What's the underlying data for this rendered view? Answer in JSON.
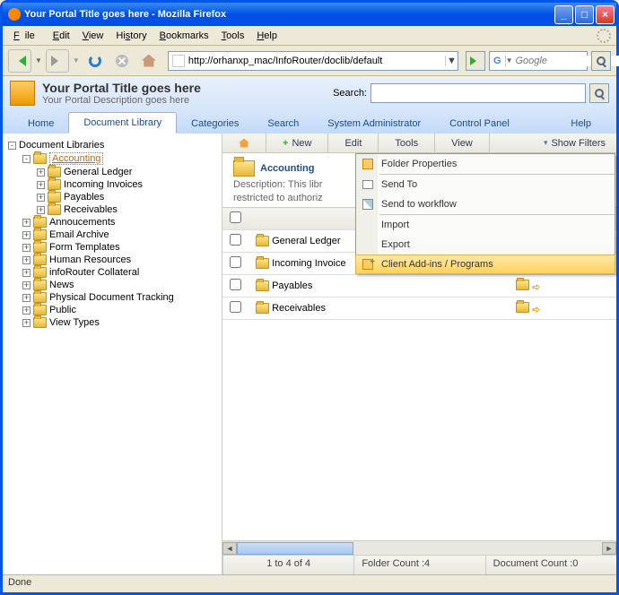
{
  "titlebar": {
    "text": "Your Portal Title goes here - Mozilla Firefox"
  },
  "menubar": [
    "File",
    "Edit",
    "View",
    "History",
    "Bookmarks",
    "Tools",
    "Help"
  ],
  "url": "http://orhanxp_mac/InfoRouter/doclib/default",
  "search_engine_placeholder": "Google",
  "portal": {
    "title": "Your Portal Title goes here",
    "description": "Your Portal Description goes here",
    "search_label": "Search:"
  },
  "nav": {
    "home": "Home",
    "doclib": "Document Library",
    "categories": "Categories",
    "search": "Search",
    "sysadmin": "System Administrator",
    "cpanel": "Control Panel",
    "help": "Help"
  },
  "tree": {
    "root": "Document Libraries",
    "accounting": "Accounting",
    "accounting_children": [
      "General Ledger",
      "Incoming Invoices",
      "Payables",
      "Receivables"
    ],
    "siblings": [
      "Annoucements",
      "Email Archive",
      "Form Templates",
      "Human Resources",
      "infoRouter Collateral",
      "News",
      "Physical Document Tracking",
      "Public",
      "View Types"
    ]
  },
  "actions": {
    "new": "New",
    "edit": "Edit",
    "tools": "Tools",
    "view": "View",
    "filters": "Show Filters"
  },
  "folder": {
    "title": "Accounting",
    "desc1": "Description: This libr",
    "desc2": "restricted to authoriz"
  },
  "table": {
    "rows": [
      "General Ledger",
      "Incoming Invoice",
      "Payables",
      "Receivables"
    ]
  },
  "tools_menu": {
    "props": "Folder Properties",
    "sendto": "Send To",
    "sendwf": "Send to workflow",
    "import": "Import",
    "export": "Export",
    "addins": "Client Add-ins / Programs"
  },
  "footer": {
    "range": "1 to 4 of 4",
    "folders": "Folder Count :4",
    "docs": "Document Count :0"
  },
  "status": "Done"
}
